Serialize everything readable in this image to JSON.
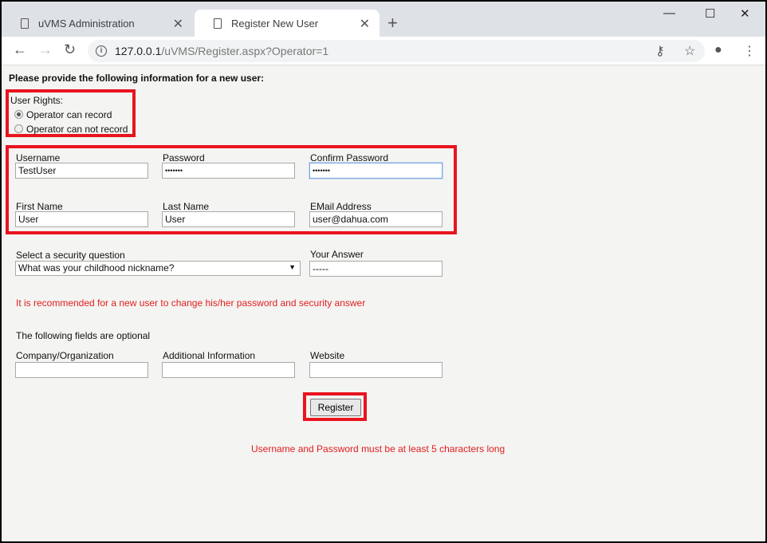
{
  "browser": {
    "tabs": [
      {
        "label": "uVMS Administration"
      },
      {
        "label": "Register New User"
      }
    ],
    "url_host": "127.0.0.1",
    "url_path": "/uVMS/Register.aspx?Operator=1"
  },
  "form": {
    "heading": "Please provide the following information for a new user:",
    "user_rights_label": "User Rights:",
    "rights_options": [
      "Operator can record",
      "Operator can not record"
    ],
    "rights_selected": "Operator can record",
    "fields": {
      "username": {
        "label": "Username",
        "value": "TestUser"
      },
      "password": {
        "label": "Password",
        "value": "•••••••"
      },
      "confirm_password": {
        "label": "Confirm Password",
        "value": "•••••••"
      },
      "first_name": {
        "label": "First Name",
        "value": "User"
      },
      "last_name": {
        "label": "Last Name",
        "value": "User"
      },
      "email": {
        "label": "EMail Address",
        "value": "user@dahua.com"
      },
      "security_question": {
        "label": "Select a security question",
        "value": "What was your childhood nickname?"
      },
      "answer": {
        "label": "Your Answer",
        "value": "-----"
      },
      "company": {
        "label": "Company/Organization",
        "value": ""
      },
      "additional": {
        "label": "Additional Information",
        "value": ""
      },
      "website": {
        "label": "Website",
        "value": ""
      }
    },
    "recommendation": "It is recommended for a new user to change his/her password and security answer",
    "optional_note": "The following fields are optional",
    "register_label": "Register",
    "error": "Username and Password must be at least 5 characters long"
  }
}
